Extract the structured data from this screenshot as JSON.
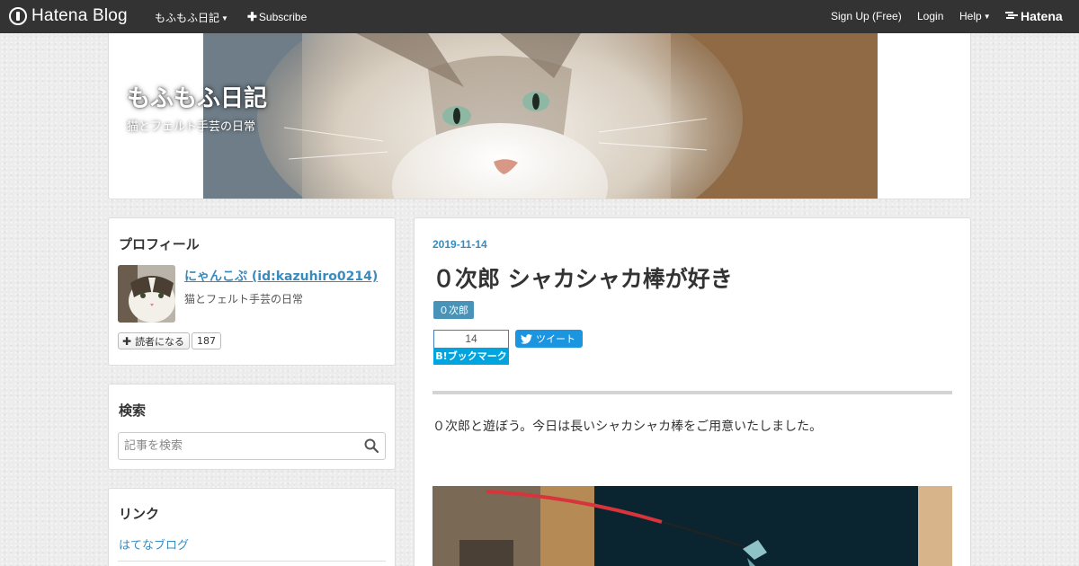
{
  "topbar": {
    "logo_text": "Hatena Blog",
    "blog_menu": "もふもふ日記",
    "subscribe": "Subscribe",
    "signup": "Sign Up (Free)",
    "login": "Login",
    "help": "Help",
    "hatena": "Hatena"
  },
  "header": {
    "title": "もふもふ日記",
    "description": "猫とフェルト手芸の日常"
  },
  "sidebar": {
    "profile": {
      "title": "プロフィール",
      "name": "にゃんこぷ (id:kazuhiro0214)",
      "description": "猫とフェルト手芸の日常",
      "reader_button": "読者になる",
      "reader_count": "187"
    },
    "search": {
      "title": "検索",
      "placeholder": "記事を検索"
    },
    "links": {
      "title": "リンク",
      "items": [
        "はてなブログ"
      ]
    }
  },
  "post": {
    "date": "2019-11-14",
    "title": "０次郎 シャカシャカ棒が好き",
    "category": "０次郎",
    "bookmark_count": "14",
    "bookmark_label": "B!ブックマーク",
    "tweet_label": "ツイート",
    "body": "０次郎と遊ぼう。今日は長いシャカシャカ棒をご用意いたしました。"
  },
  "colors": {
    "topbar": "#333333",
    "link": "#3a8bbd",
    "category_bg": "#4a93b8",
    "bookmark_bg": "#00a4de",
    "tweet_bg": "#1b95e0"
  }
}
